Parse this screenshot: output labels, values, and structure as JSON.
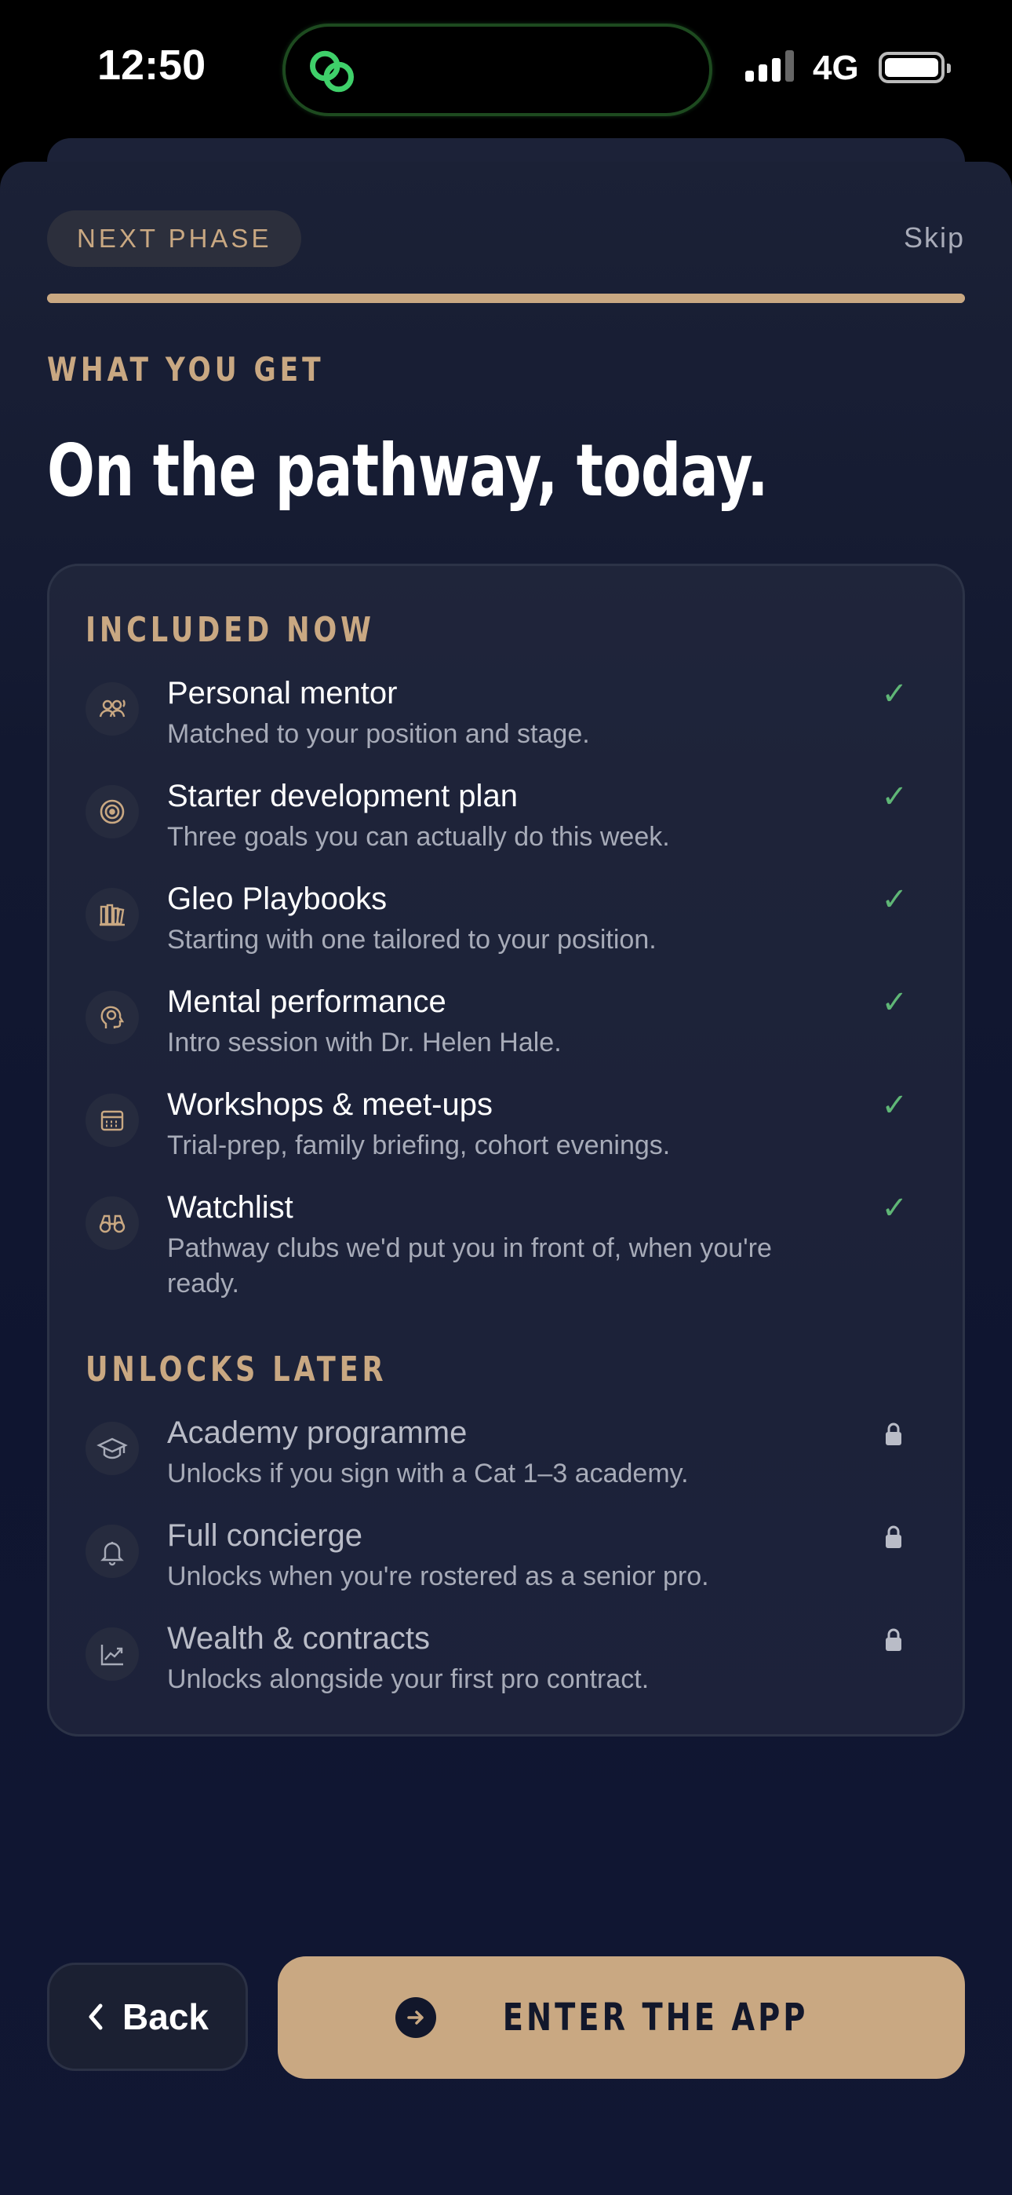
{
  "status_bar": {
    "time": "12:50",
    "network": "4G"
  },
  "header": {
    "phase_label": "NEXT PHASE",
    "skip_label": "Skip",
    "progress_percent": 100
  },
  "intro": {
    "eyebrow": "WHAT YOU GET",
    "title": "On the pathway, today."
  },
  "included": {
    "title": "INCLUDED NOW",
    "items": [
      {
        "icon": "mentor-group-icon",
        "title": "Personal mentor",
        "desc": "Matched to your position and stage."
      },
      {
        "icon": "target-icon",
        "title": "Starter development plan",
        "desc": "Three goals you can actually do this week."
      },
      {
        "icon": "playbooks-icon",
        "title": "Gleo Playbooks",
        "desc": "Starting with one tailored to your position."
      },
      {
        "icon": "brain-head-icon",
        "title": "Mental performance",
        "desc": "Intro session with Dr. Helen Hale."
      },
      {
        "icon": "calendar-icon",
        "title": "Workshops & meet-ups",
        "desc": "Trial-prep, family briefing, cohort evenings."
      },
      {
        "icon": "binoculars-icon",
        "title": "Watchlist",
        "desc": "Pathway clubs we'd put you in front of, when you're ready."
      }
    ]
  },
  "later": {
    "title": "UNLOCKS LATER",
    "items": [
      {
        "icon": "graduation-cap-icon",
        "title": "Academy programme",
        "desc": "Unlocks if you sign with a Cat 1–3 academy."
      },
      {
        "icon": "bell-icon",
        "title": "Full concierge",
        "desc": "Unlocks when you're rostered as a senior pro."
      },
      {
        "icon": "trend-chart-icon",
        "title": "Wealth & contracts",
        "desc": "Unlocks alongside your first pro contract."
      }
    ]
  },
  "footer": {
    "back_label": "Back",
    "enter_label": "ENTER THE APP"
  },
  "colors": {
    "accent": "#c9a882",
    "check": "#5fb676",
    "background": "#121830"
  }
}
